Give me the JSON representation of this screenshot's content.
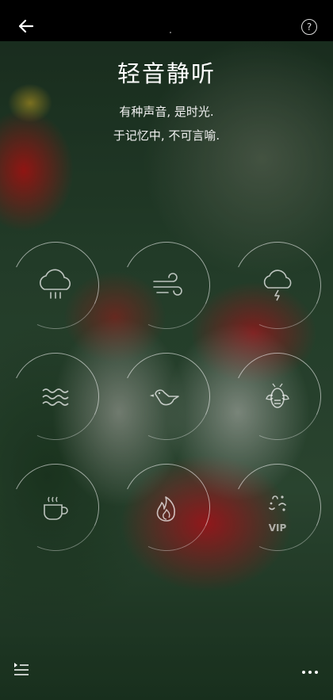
{
  "header": {
    "back_icon": "arrow-left-icon",
    "help_icon": "help-circle-icon",
    "help_glyph": "?"
  },
  "title": "轻音静听",
  "subtitle_lines": [
    "有种声音, 是时光.",
    "于记忆中, 不可言喻."
  ],
  "sounds": [
    {
      "icon": "rain-cloud-icon"
    },
    {
      "icon": "wind-icon"
    },
    {
      "icon": "thunderstorm-icon"
    },
    {
      "icon": "waves-icon"
    },
    {
      "icon": "bird-icon"
    },
    {
      "icon": "cicada-icon"
    },
    {
      "icon": "hot-coffee-icon"
    },
    {
      "icon": "fire-icon"
    },
    {
      "icon": "stars-icon",
      "badge": "VIP"
    }
  ],
  "footer": {
    "playlist_icon": "playlist-icon",
    "more_icon": "more-dots-icon"
  },
  "colors": {
    "topbar": "#000000",
    "text": "#ffffff",
    "ring": "#ffffff"
  }
}
